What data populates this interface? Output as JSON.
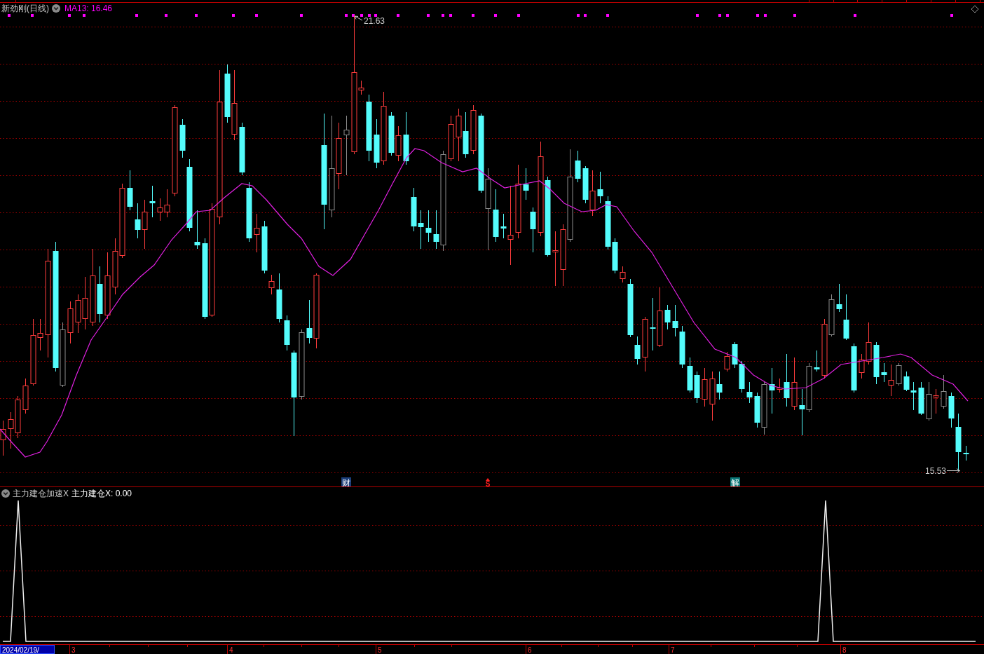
{
  "main_chart": {
    "title": "新劲刚(日线)",
    "ma_label": "MA13: 16.46",
    "high_label": "21.63",
    "low_label": "15.53",
    "event_markers": [
      {
        "kind": "finance",
        "label": "财"
      },
      {
        "kind": "signal",
        "label": "S"
      },
      {
        "kind": "unlock",
        "label": "解"
      }
    ]
  },
  "indicator_panel": {
    "name": "主力建仓加速X",
    "value_label": "主力建仓X: 0.00"
  },
  "time_axis": {
    "date_label": "2024/02/19/",
    "months": [
      "3",
      "4",
      "5",
      "6",
      "7",
      "8"
    ]
  }
}
